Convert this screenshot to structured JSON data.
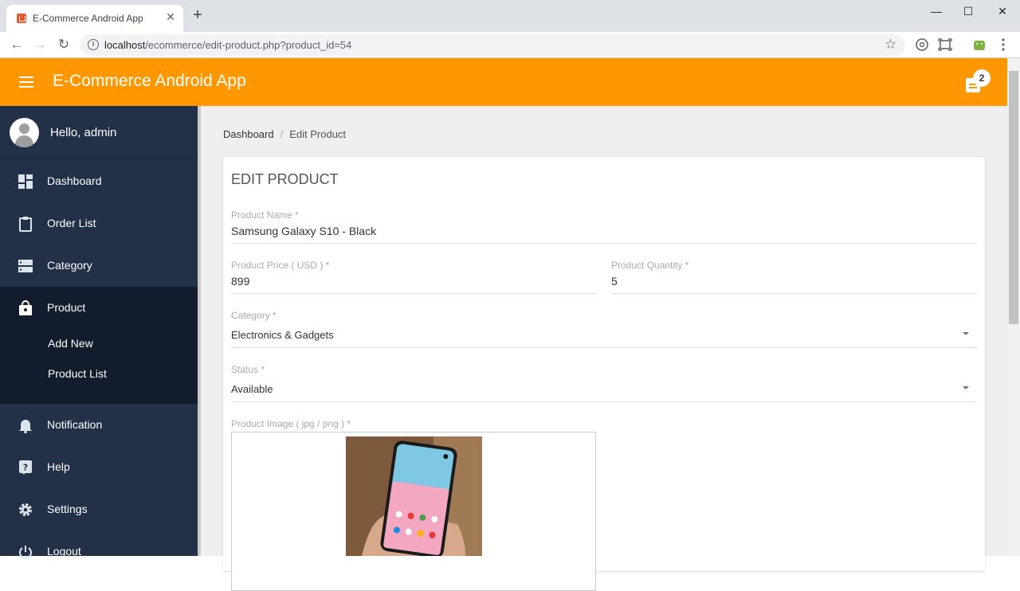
{
  "browser": {
    "tab_title": "E-Commerce Android App",
    "tab_close": "✕",
    "new_tab": "+",
    "url_host": "localhost",
    "url_path": "/ecommerce/edit-product.php?product_id=54",
    "window_controls": {
      "minimize": "—",
      "maximize": "☐",
      "close": "✕"
    },
    "nav": {
      "back": "←",
      "forward": "→",
      "reload": "↻"
    }
  },
  "appbar": {
    "title": "E-Commerce Android App",
    "notification_count": "2",
    "color": "#ff9800"
  },
  "sidebar": {
    "greeting": "Hello, admin",
    "items": [
      {
        "label": "Dashboard",
        "icon": "dashboard-icon"
      },
      {
        "label": "Order List",
        "icon": "clipboard-icon"
      },
      {
        "label": "Category",
        "icon": "category-icon"
      },
      {
        "label": "Product",
        "icon": "shopping-bag-icon",
        "active": true
      },
      {
        "label": "Notification",
        "icon": "bell-icon"
      },
      {
        "label": "Help",
        "icon": "help-icon"
      },
      {
        "label": "Settings",
        "icon": "gear-icon"
      },
      {
        "label": "Logout",
        "icon": "power-icon"
      }
    ],
    "submenu": [
      {
        "label": "Add New"
      },
      {
        "label": "Product List"
      }
    ]
  },
  "breadcrumb": {
    "items": [
      "Dashboard",
      "Edit Product"
    ],
    "separator": "/"
  },
  "form": {
    "title": "EDIT PRODUCT",
    "product_name": {
      "label": "Product Name *",
      "value": "Samsung Galaxy S10 - Black"
    },
    "product_price": {
      "label": "Product Price ( USD ) *",
      "value": "899"
    },
    "product_quantity": {
      "label": "Product Quantity *",
      "value": "5"
    },
    "category": {
      "label": "Category *",
      "value": "Electronics & Gadgets"
    },
    "status": {
      "label": "Status *",
      "value": "Available"
    },
    "product_image": {
      "label": "Product Image ( jpg / png ) *"
    }
  }
}
